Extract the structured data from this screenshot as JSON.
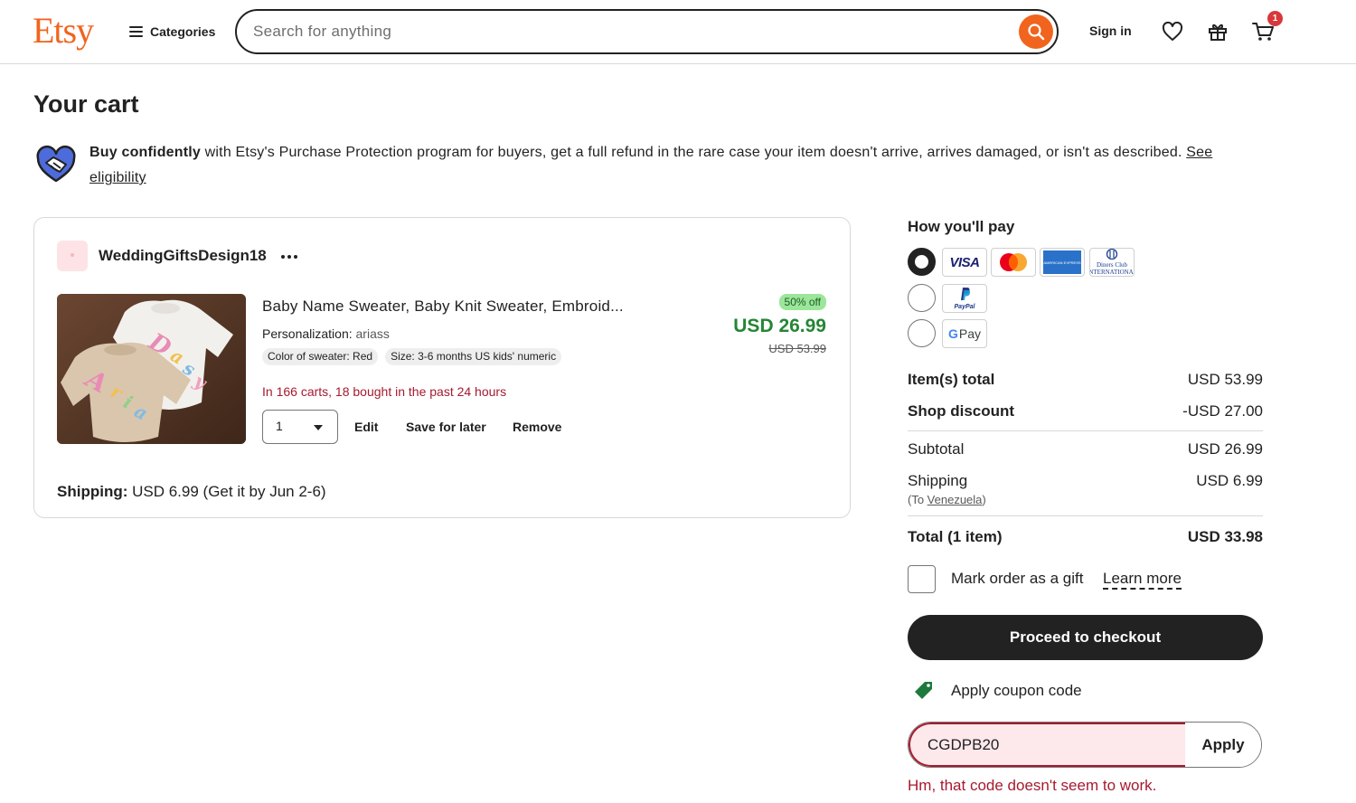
{
  "header": {
    "logo": "Etsy",
    "categories_label": "Categories",
    "search_placeholder": "Search for anything",
    "signin_label": "Sign in",
    "cart_count": "1",
    "icons": [
      "search-icon",
      "heart-icon",
      "gift-icon",
      "cart-icon"
    ]
  },
  "page": {
    "title": "Your cart",
    "protection": {
      "bold": "Buy confidently",
      "text": " with Etsy's Purchase Protection program for buyers, get a full refund in the rare case your item doesn't arrive, arrives damaged, or isn't as described. ",
      "link": "See eligibility"
    }
  },
  "cart": {
    "shop_name": "WeddingGiftsDesign18",
    "item": {
      "title": "Baby Name Sweater, Baby Knit Sweater, Embroid...",
      "personalization_label": "Personalization:",
      "personalization_value": "ariass",
      "variations": [
        "Color of sweater: Red",
        "Size: 3-6 months US kids' numeric"
      ],
      "popularity": "In 166 carts, 18 bought in the past 24 hours",
      "quantity": "1",
      "actions": {
        "edit": "Edit",
        "save": "Save for later",
        "remove": "Remove"
      },
      "discount_badge": "50% off",
      "price": "USD 26.99",
      "original_price": "USD 53.99"
    },
    "shipping_label": "Shipping:",
    "shipping_value": "USD 6.99 (Get it by Jun 2-6)"
  },
  "payment": {
    "title": "How you'll pay",
    "options": [
      {
        "name": "cards",
        "selected": true,
        "logos": [
          "VISA",
          "Mastercard",
          "American Express",
          "Diners Club International"
        ]
      },
      {
        "name": "paypal",
        "selected": false,
        "logos": [
          "PayPal"
        ]
      },
      {
        "name": "gpay",
        "selected": false,
        "logos": [
          "G Pay"
        ]
      }
    ],
    "logo_text": {
      "visa": "VISA",
      "amex": "AMERICAN EXPRESS",
      "diners": "Diners Club INTERNATIONAL",
      "paypal": "PayPal",
      "gpay_g": "G",
      "gpay_pay": "Pay"
    }
  },
  "summary": {
    "items_total_label": "Item(s) total",
    "items_total": "USD 53.99",
    "shop_discount_label": "Shop discount",
    "shop_discount": "-USD 27.00",
    "subtotal_label": "Subtotal",
    "subtotal": "USD 26.99",
    "shipping_label": "Shipping",
    "shipping": "USD 6.99",
    "shipping_to_prefix": "(To ",
    "shipping_to_country": "Venezuela",
    "shipping_to_suffix": ")",
    "total_label": "Total (1 item)",
    "total": "USD 33.98"
  },
  "gift": {
    "label": "Mark order as a gift",
    "learn_more": "Learn more"
  },
  "checkout_label": "Proceed to checkout",
  "coupon": {
    "label": "Apply coupon code",
    "value": "CGDPB20",
    "apply_label": "Apply",
    "error": "Hm, that code doesn't seem to work."
  },
  "colors": {
    "brand": "#f1641e",
    "price_green": "#258635",
    "error_red": "#a61a2e",
    "badge_green": "#9be69b"
  }
}
